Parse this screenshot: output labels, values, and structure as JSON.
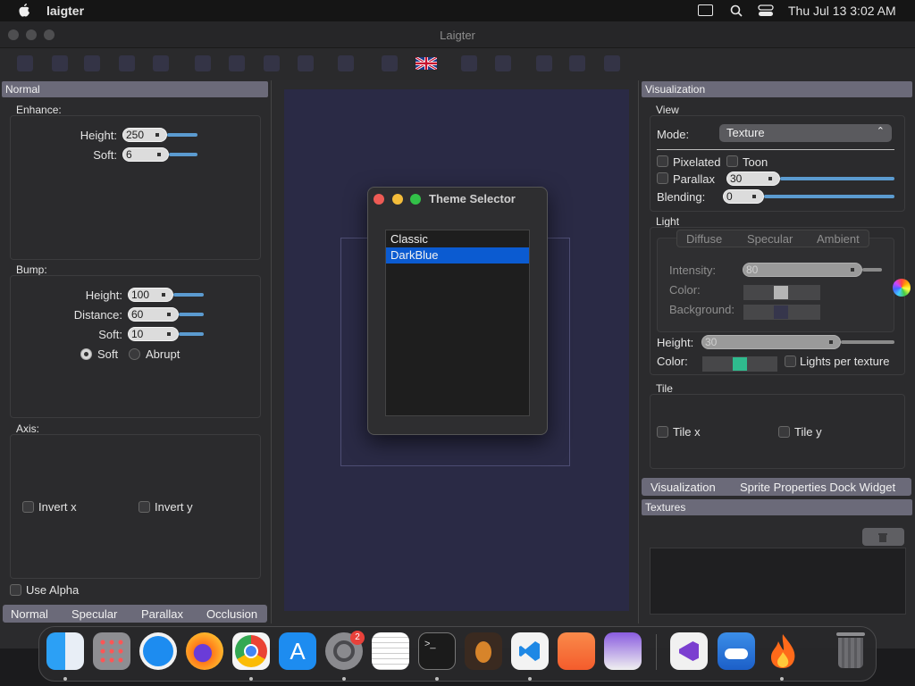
{
  "menubar": {
    "app_name": "laigter",
    "clock": "Thu Jul 13  3:02 AM",
    "icons": [
      "apple-icon",
      "window-icon",
      "search-icon",
      "control-center-icon"
    ]
  },
  "window": {
    "title": "Laigter"
  },
  "normal_panel": {
    "header": "Normal",
    "enhance": {
      "label": "Enhance:",
      "height_label": "Height:",
      "height_value": "250",
      "soft_label": "Soft:",
      "soft_value": "6"
    },
    "bump": {
      "label": "Bump:",
      "height_label": "Height:",
      "height_value": "100",
      "distance_label": "Distance:",
      "distance_value": "60",
      "soft_label": "Soft:",
      "soft_value": "10",
      "radio_soft": "Soft",
      "radio_abrupt": "Abrupt"
    },
    "axis": {
      "label": "Axis:",
      "invert_x": "Invert x",
      "invert_y": "Invert y"
    },
    "use_alpha": "Use Alpha",
    "tabs": [
      "Normal",
      "Specular",
      "Parallax",
      "Occlusion"
    ]
  },
  "theme_dialog": {
    "title": "Theme Selector",
    "items": [
      "Classic",
      "DarkBlue"
    ],
    "selected": "DarkBlue"
  },
  "visualization_panel": {
    "header": "Visualization",
    "view": {
      "label": "View",
      "mode_label": "Mode:",
      "mode_value": "Texture",
      "pixelated": "Pixelated",
      "toon": "Toon",
      "parallax": "Parallax",
      "parallax_value": "30",
      "blending_label": "Blending:",
      "blending_value": "0"
    },
    "light": {
      "label": "Light",
      "tabs": [
        "Diffuse",
        "Specular",
        "Ambient"
      ],
      "intensity_label": "Intensity:",
      "intensity_value": "80",
      "color_label": "Color:",
      "background_label": "Background:",
      "height_label": "Height:",
      "height_value": "30",
      "color2_label": "Color:",
      "lights_per_texture": "Lights per texture"
    },
    "tile": {
      "label": "Tile",
      "tile_x": "Tile x",
      "tile_y": "Tile y"
    },
    "tabs": [
      "Visualization",
      "Sprite Properties Dock Widget"
    ]
  },
  "textures_panel": {
    "header": "Textures"
  },
  "dock": {
    "badge": "2",
    "apps": [
      "finder-icon",
      "launchpad-icon",
      "safari-icon",
      "firefox-icon",
      "chrome-icon",
      "app-store-icon",
      "system-settings-icon",
      "textedit-icon",
      "terminal-icon",
      "garageband-icon",
      "vscode-icon",
      "pages-icon",
      "laigter-icon",
      "visual-studio-icon",
      "weather-icon",
      "flame-icon",
      "trash-icon"
    ]
  },
  "colors": {
    "accent": "#0b5bd1",
    "slider": "#5b9bd0",
    "light_color": "#2fbb8e",
    "dock_header": "#6b6a79",
    "canvas": "#2a2a45"
  }
}
